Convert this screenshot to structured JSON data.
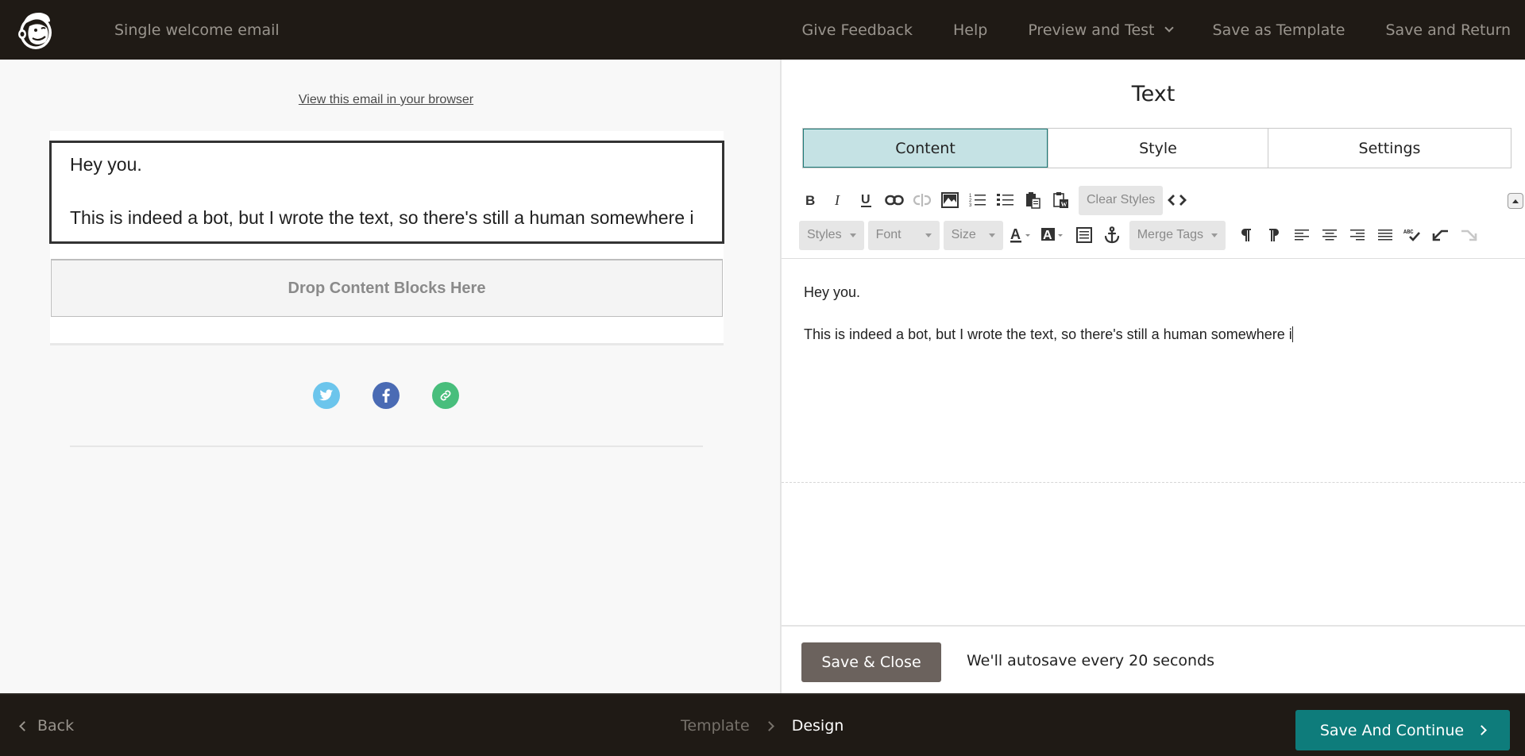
{
  "header": {
    "title": "Single welcome email",
    "nav": {
      "give_feedback": "Give Feedback",
      "help": "Help",
      "preview_and_test": "Preview and Test",
      "save_as_template": "Save as Template",
      "save_and_return": "Save and Return"
    }
  },
  "canvas": {
    "view_in_browser": "View this email in your browser",
    "text_block": {
      "line1": "Hey you.",
      "line2": "This is indeed a bot, but I wrote the text, so there's still a human somewhere i"
    },
    "drop_zone": "Drop Content Blocks Here",
    "social_icons": [
      {
        "name": "twitter",
        "color": "#6cc5ec"
      },
      {
        "name": "facebook",
        "color": "#4a6bb4"
      },
      {
        "name": "link",
        "color": "#48be7c"
      }
    ]
  },
  "panel": {
    "title": "Text",
    "tabs": [
      {
        "label": "Content",
        "active": true
      },
      {
        "label": "Style",
        "active": false
      },
      {
        "label": "Settings",
        "active": false
      }
    ],
    "toolbar": {
      "row1": [
        "bold",
        "italic",
        "underline",
        "link",
        "unlink",
        "image",
        "ordered-list",
        "unordered-list",
        "paste",
        "paste-from-word",
        "clear-styles",
        "source-code"
      ],
      "clear_styles": "Clear Styles",
      "styles": "Styles",
      "font": "Font",
      "size": "Size",
      "merge_tags": "Merge Tags",
      "row2": [
        "styles",
        "font",
        "size",
        "text-color",
        "background-color",
        "block",
        "anchor",
        "merge-tags",
        "ltr",
        "rtl",
        "align-left",
        "align-center",
        "align-right",
        "align-justify",
        "spellcheck",
        "undo",
        "redo"
      ]
    },
    "editor": {
      "line1": "Hey you.",
      "line2": "This is indeed a bot, but I wrote the text, so there's still a human somewhere i"
    },
    "save_close": "Save & Close",
    "autosave_note": "We'll autosave every 20 seconds"
  },
  "footer": {
    "back": "Back",
    "breadcrumb": {
      "template": "Template",
      "design": "Design"
    },
    "save_continue": "Save And Continue"
  },
  "colors": {
    "topbar_bg": "#1f1a15",
    "accent_teal": "#0e7c7b",
    "active_tab_bg": "#c5e2e4",
    "save_close_bg": "#6b625d"
  }
}
